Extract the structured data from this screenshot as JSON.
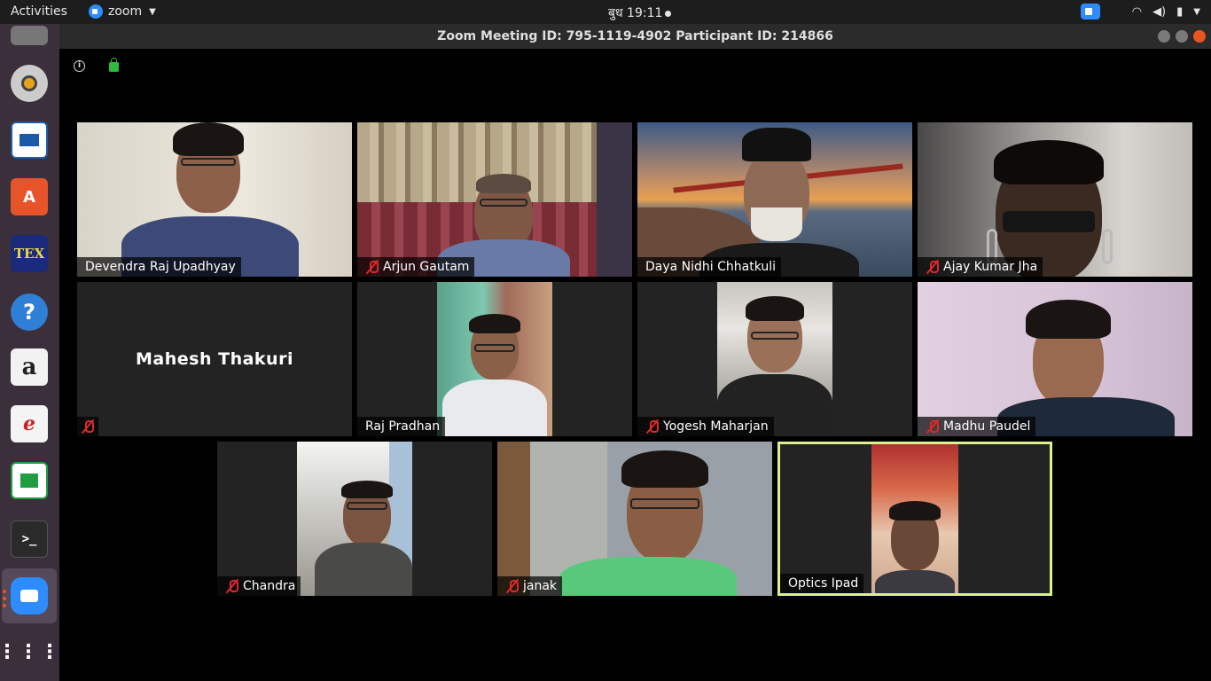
{
  "topbar": {
    "activities": "Activities",
    "app_name": "zoom",
    "clock": "बुध 19:11"
  },
  "window": {
    "title": "Zoom Meeting ID: 795-1119-4902 Participant ID: 214866"
  },
  "dock": {
    "items": [
      "settings-icon",
      "rhythmbox-icon",
      "libreoffice-impress-icon",
      "software-center-icon",
      "texmaker-icon",
      "help-icon",
      "amazon-icon",
      "document-viewer-icon",
      "libreoffice-calc-icon",
      "terminal-icon",
      "zoom-icon",
      "show-apps-icon"
    ],
    "texmaker_label": "TEX",
    "amazon_label": "a"
  },
  "participants": [
    {
      "name": "Devendra Raj Upadhyay",
      "muted": false,
      "video": true
    },
    {
      "name": "Arjun Gautam",
      "muted": true,
      "video": true
    },
    {
      "name": "Daya Nidhi Chhatkuli",
      "muted": false,
      "video": true
    },
    {
      "name": "Ajay Kumar Jha",
      "muted": true,
      "video": true
    },
    {
      "name": "Mahesh Thakuri",
      "muted": true,
      "video": false
    },
    {
      "name": "Raj Pradhan",
      "muted": false,
      "video": true
    },
    {
      "name": "Yogesh Maharjan",
      "muted": true,
      "video": true
    },
    {
      "name": "Madhu Paudel",
      "muted": true,
      "video": true
    },
    {
      "name": "Chandra",
      "muted": true,
      "video": true
    },
    {
      "name": "janak",
      "muted": true,
      "video": true
    },
    {
      "name": "Optics Ipad",
      "muted": false,
      "video": true,
      "active_speaker": true
    }
  ],
  "colors": {
    "zoom_blue": "#2d8cff",
    "mute_red": "#e02828",
    "active_speaker_border": "#d9f28b",
    "tile_bg": "#232323"
  }
}
